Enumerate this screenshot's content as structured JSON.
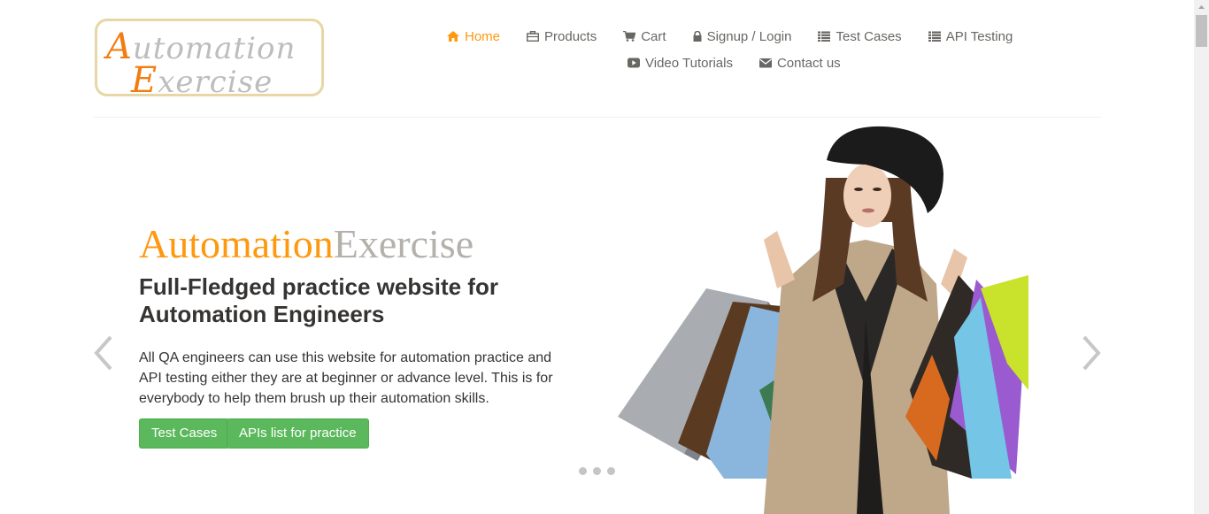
{
  "logo": {
    "line1_cap": "A",
    "line1_rest": "utomation",
    "line2_cap": "E",
    "line2_rest": "xercise"
  },
  "nav": {
    "row1": [
      {
        "label": "Home",
        "icon": "home-icon",
        "active": true
      },
      {
        "label": "Products",
        "icon": "products-icon"
      },
      {
        "label": "Cart",
        "icon": "cart-icon"
      },
      {
        "label": "Signup / Login",
        "icon": "lock-icon"
      },
      {
        "label": "Test Cases",
        "icon": "list-icon"
      },
      {
        "label": "API Testing",
        "icon": "list-icon"
      }
    ],
    "row2": [
      {
        "label": "Video Tutorials",
        "icon": "youtube-play-icon"
      },
      {
        "label": "Contact us",
        "icon": "envelope-icon"
      }
    ]
  },
  "slider": {
    "brand_part1": "Automation",
    "brand_part2": "Exercise",
    "headline": "Full-Fledged practice website for Automation Engineers",
    "description": "All QA engineers can use this website for automation practice and API testing either they are at beginner or advance level. This is for everybody to help them brush up their automation skills.",
    "button_test_cases": "Test Cases",
    "button_apis": "APIs list for practice",
    "dots": 3
  },
  "colors": {
    "accent": "#fe980f",
    "brand_gray": "#b4b1ab",
    "button_green": "#5cb85c",
    "nav_text": "#696763"
  }
}
